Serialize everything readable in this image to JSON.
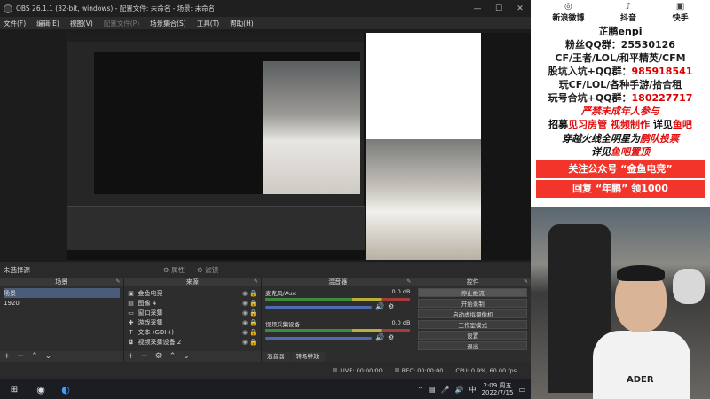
{
  "obs": {
    "title": "OBS 26.1.1 (32-bit, windows) - 配置文件: 未命名 - 场景: 未命名",
    "menu": [
      "文件(F)",
      "编辑(E)",
      "视图(V)",
      "配置文件(P)",
      "场景集合(S)",
      "工具(T)",
      "帮助(H)"
    ],
    "no_source_selected": "未选择源",
    "properties_label": "属性",
    "filters_label": "滤镜",
    "docks": {
      "scenes": {
        "title": "场景",
        "items": [
          "场景",
          "1920"
        ]
      },
      "sources": {
        "title": "来源",
        "items": [
          {
            "icon": "monitor-icon",
            "label": "金鱼电竞"
          },
          {
            "icon": "image-icon",
            "label": "图像 4"
          },
          {
            "icon": "window-icon",
            "label": "窗口采集"
          },
          {
            "icon": "gamepad-icon",
            "label": "游戏采集"
          },
          {
            "icon": "text-icon",
            "label": "文本 (GDI+)"
          },
          {
            "icon": "camera-icon",
            "label": "视频采集设备 2"
          }
        ]
      },
      "mixer": {
        "title": "混音器",
        "channels": [
          {
            "name": "麦克风/Aux",
            "db": "0.0 dB"
          },
          {
            "name": "视频采集设备",
            "db": "0.0 dB"
          }
        ],
        "tabs": [
          "混音器",
          "转场特效"
        ]
      },
      "controls": {
        "title": "控件",
        "buttons": [
          "停止推流",
          "开始录制",
          "启动虚拟摄像机",
          "工作室模式",
          "设置",
          "退出"
        ]
      }
    },
    "status": {
      "live": "LIVE: 00:00:00",
      "rec": "REC: 00:00:00",
      "cpu": "CPU: 0.9%, 60.00 fps"
    }
  },
  "taskbar": {
    "time": "2:09 周五",
    "date": "2022/7/15"
  },
  "overlay": {
    "social": [
      {
        "icon": "weibo-icon",
        "label": "新浪微博"
      },
      {
        "icon": "tiktok-icon",
        "label": "抖音"
      },
      {
        "icon": "kuaishou-icon",
        "label": "快手"
      }
    ],
    "name": "芷鹏enpi",
    "lines": [
      {
        "text": "粉丝QQ群：25530126",
        "style": "black"
      },
      {
        "text": "CF/王者/LOL/和平精英/CFM",
        "style": "black"
      },
      {
        "pre": "股坑入坑+QQ群：",
        "red": "985918541",
        "style": "blackred"
      },
      {
        "text": "玩CF/LOL/各种手游/拾合租",
        "style": "black"
      },
      {
        "pre": "玩号合坑+QQ群：",
        "red": "180227717",
        "style": "blackred"
      },
      {
        "text": "严禁未成年人参与",
        "style": "red"
      }
    ],
    "recruit": {
      "pre": "招募",
      "red1": "见习房管 视频制作",
      "mid": " 详见",
      "red2": "鱼吧"
    },
    "cf_line1": {
      "pre": "穿越火线全明星为",
      "red": "鹏队投票"
    },
    "cf_line2": {
      "pre": "详见",
      "red": "鱼吧置顶"
    },
    "box1": "关注公众号 “金鱼电竞”",
    "box2": "回复 “年鹏” 领1000"
  },
  "camera": {
    "brand": "ADER"
  }
}
